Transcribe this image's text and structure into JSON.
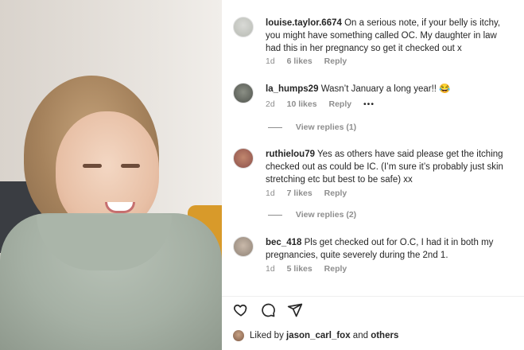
{
  "comments": [
    {
      "username": "louise.taylor.6674",
      "text": "On a serious note, if your belly is itchy, you might have something called OC. My daughter in law had this in her pregnancy so get it checked out x",
      "age": "1d",
      "likes": "6 likes",
      "reply_label": "Reply"
    },
    {
      "username": "la_humps29",
      "text": "Wasn’t January a long year!! 😂",
      "age": "2d",
      "likes": "10 likes",
      "reply_label": "Reply",
      "more": "•••",
      "view_replies": "View replies (1)"
    },
    {
      "username": "ruthielou79",
      "text": "Yes as others have said please get the itching checked out as could be IC. (I’m sure it’s probably just skin stretching etc but best to be safe) xx",
      "age": "1d",
      "likes": "7 likes",
      "reply_label": "Reply",
      "view_replies": "View replies (2)"
    },
    {
      "username": "bec_418",
      "text": "Pls get checked out for O.C, I had it in both my pregnancies, quite severely during the 2nd 1.",
      "age": "1d",
      "likes": "5 likes",
      "reply_label": "Reply"
    }
  ],
  "actions": {
    "like_icon": "heart-icon",
    "comment_icon": "comment-icon",
    "share_icon": "share-icon"
  },
  "liked_by": {
    "prefix": "Liked by",
    "user": "jason_carl_fox",
    "connector": "and",
    "suffix": "others"
  }
}
